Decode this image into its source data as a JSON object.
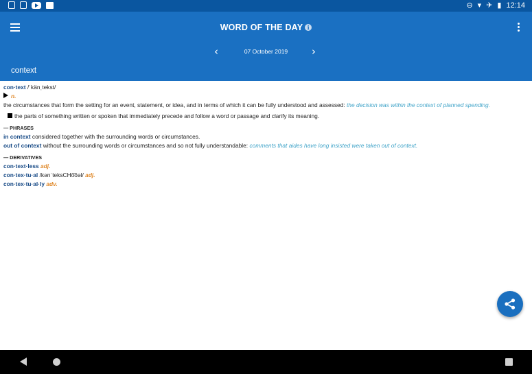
{
  "status": {
    "time": "12:14",
    "left_icons": [
      "sim-card-icon",
      "sim-card-icon",
      "youtube-icon",
      "image-icon"
    ],
    "right_icons": [
      "do-not-disturb-icon",
      "wifi-icon",
      "airplane-icon",
      "battery-icon"
    ]
  },
  "app_bar": {
    "title": "WORD OF THE DAY",
    "info_glyph": "i",
    "date": "07 October 2019",
    "prev_glyph": "‹",
    "next_glyph": "›",
    "word": "context"
  },
  "entry": {
    "headword": "con·text",
    "pronunciation": "/ˈkänˌtekst/",
    "pos": "n.",
    "def1_text": "the circumstances that form the setting for an event, statement, or idea, and in terms of which it can be fully understood and assessed:",
    "def1_example": "the decision was within the context of planned spending.",
    "def2_text": "the parts of something written or spoken that immediately precede and follow a word or passage and clarify its meaning."
  },
  "phrases": {
    "heading": "— PHRASES",
    "items": [
      {
        "phrase": "in context",
        "text": "considered together with the surrounding words or circumstances.",
        "example": ""
      },
      {
        "phrase": "out of context",
        "text": "without the surrounding words or circumstances and so not fully understandable:",
        "example": "comments that aides have long insisted were taken out of context."
      }
    ]
  },
  "derivatives": {
    "heading": "— DERIVATIVES",
    "items": [
      {
        "word": "con·text·less",
        "pronunciation": "",
        "pos": "adj."
      },
      {
        "word": "con·tex·tu·al",
        "pronunciation": "/kənˈteksCHo͞oəl/",
        "pos": "adj."
      },
      {
        "word": "con·tex·tu·al·ly",
        "pronunciation": "",
        "pos": "adv."
      }
    ]
  },
  "fab": {
    "icon": "share-icon"
  },
  "nav": {
    "icons": [
      "back-icon",
      "home-icon",
      "recents-icon"
    ]
  },
  "colors": {
    "status_bar": "#0a56a0",
    "app_bar": "#1a70c2",
    "headword": "#174a86",
    "pos": "#e08a2c",
    "example": "#3fa3c8",
    "fab": "#1a6fbf"
  }
}
